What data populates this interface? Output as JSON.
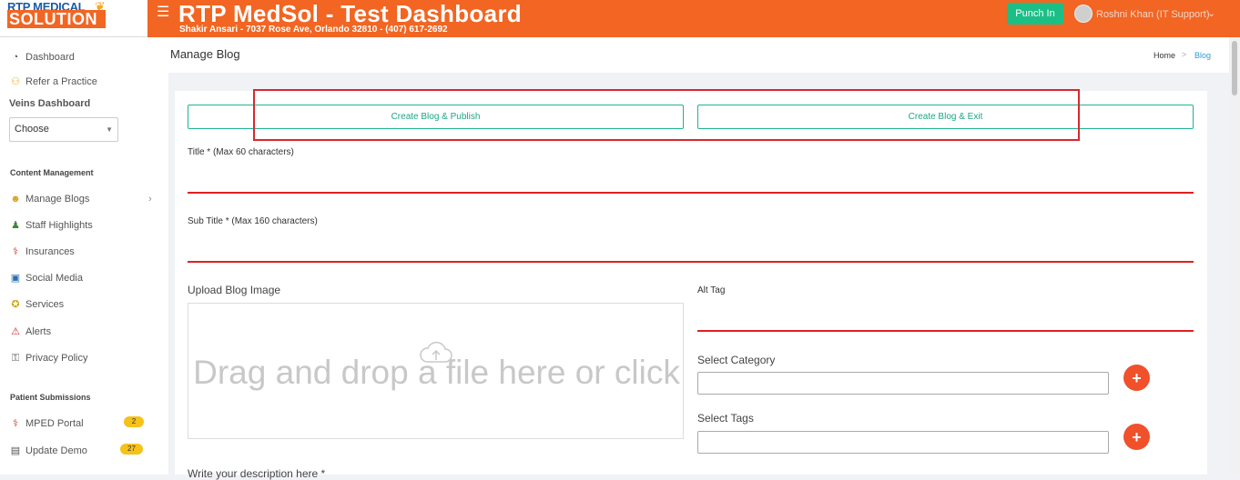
{
  "logo": {
    "top": "RTP MEDICAL",
    "bottom": "SOLUTION"
  },
  "header": {
    "title": "RTP MedSol - Test Dashboard",
    "subtitle": "Shakir Ansari - 7037 Rose Ave, Orlando 32810 - (407) 617-2692",
    "punch_label": "Punch In",
    "user_name": "Roshni Khan (IT Support)",
    "chevron": "⌄"
  },
  "sidebar": {
    "items_top": [
      {
        "label": "Dashboard",
        "icon": "gauge-icon"
      },
      {
        "label": "Refer a Practice",
        "icon": "refer-icon"
      }
    ],
    "veins_label": "Veins Dashboard",
    "choose_value": "Choose",
    "content_heading": "Content Management",
    "content_items": [
      {
        "label": "Manage Blogs",
        "icon": "blog-icon"
      },
      {
        "label": "Staff Highlights",
        "icon": "staff-icon"
      },
      {
        "label": "Insurances",
        "icon": "insurance-icon"
      },
      {
        "label": "Social Media",
        "icon": "social-icon"
      },
      {
        "label": "Services",
        "icon": "services-icon"
      },
      {
        "label": "Alerts",
        "icon": "alert-icon"
      },
      {
        "label": "Privacy Policy",
        "icon": "privacy-icon"
      }
    ],
    "patient_heading": "Patient Submissions",
    "patient_items": [
      {
        "label": "MPED Portal",
        "badge": "2",
        "icon": "portal-icon"
      },
      {
        "label": "Update Demo",
        "badge": "27",
        "icon": "demo-icon"
      }
    ]
  },
  "page": {
    "title": "Manage Blog",
    "breadcrumb": {
      "home": "Home",
      "sep": ">",
      "current": "Blog"
    }
  },
  "form": {
    "publish_label": "Create Blog & Publish",
    "exit_label": "Create Blog & Exit",
    "title_label": "Title * (Max 60 characters)",
    "subtitle_label": "Sub Title * (Max 160 characters)",
    "upload_label": "Upload Blog Image",
    "dropzone_text": "Drag and drop a file here or click",
    "alt_label": "Alt Tag",
    "category_label": "Select Category",
    "tags_label": "Select Tags",
    "add_symbol": "+",
    "description_label": "Write your description here *"
  },
  "colors": {
    "brand": "#f26522",
    "accent": "#1bbf86",
    "error_line": "#e02020",
    "badge": "#f5c21b"
  }
}
